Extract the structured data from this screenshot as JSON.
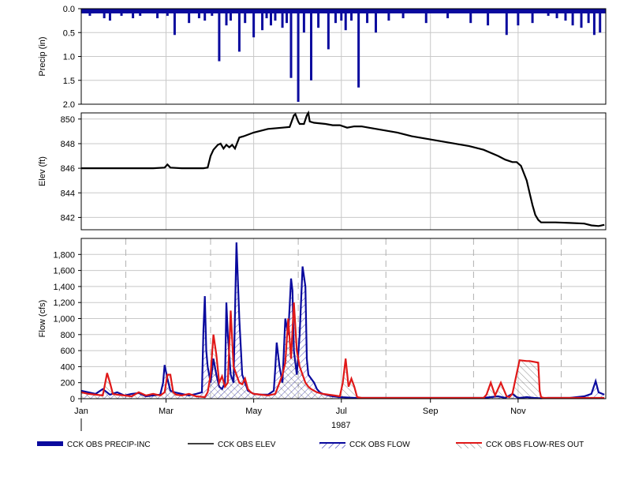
{
  "chart_data": [
    {
      "type": "bar",
      "ylabel": "Precip (in)",
      "ylim": [
        0,
        2.0
      ],
      "inverted_y": true,
      "yticks": [
        "0.0",
        "0.5",
        "1.0",
        "1.5",
        "2.0"
      ],
      "ytick_values": [
        0,
        0.5,
        1.0,
        1.5,
        2.0
      ],
      "series": [
        {
          "name": "CCK OBS PRECIP-INC",
          "color": "#0a0a9e",
          "days": [
            6,
            8,
            16,
            20,
            28,
            32,
            36,
            41,
            50,
            53,
            57,
            60,
            65,
            75,
            82,
            86,
            91,
            96,
            101,
            104,
            110,
            114,
            120,
            126,
            129,
            132,
            135,
            140,
            143,
            146,
            151,
            155,
            160,
            165,
            172,
            177,
            181,
            184,
            188,
            193,
            199,
            205,
            214,
            224,
            240,
            255,
            271,
            283,
            296,
            304,
            314,
            325,
            331,
            337,
            342,
            348,
            353,
            357,
            361
          ],
          "values": [
            0.15,
            0.1,
            0.2,
            0.25,
            0.15,
            0.1,
            0.2,
            0.15,
            0.1,
            0.2,
            0.1,
            0.15,
            0.55,
            0.3,
            0.2,
            0.25,
            0.15,
            1.1,
            0.35,
            0.25,
            0.9,
            0.3,
            0.6,
            0.45,
            0.2,
            0.35,
            0.25,
            0.4,
            0.3,
            1.45,
            1.95,
            0.5,
            1.5,
            0.4,
            0.85,
            0.3,
            0.25,
            0.45,
            0.25,
            1.65,
            0.3,
            0.5,
            0.25,
            0.2,
            0.3,
            0.2,
            0.3,
            0.35,
            0.55,
            0.35,
            0.3,
            0.15,
            0.2,
            0.25,
            0.35,
            0.4,
            0.3,
            0.55,
            0.5
          ]
        }
      ]
    },
    {
      "type": "line",
      "ylabel": "Elev (ft)",
      "ylim": [
        841,
        850.5
      ],
      "yticks": [
        "842",
        "844",
        "846",
        "848",
        "850"
      ],
      "ytick_values": [
        842,
        844,
        846,
        848,
        850
      ],
      "series": [
        {
          "name": "CCK OBS ELEV",
          "color": "#000000",
          "days": [
            0,
            10,
            20,
            30,
            40,
            50,
            58,
            60,
            62,
            70,
            80,
            85,
            88,
            90,
            92,
            95,
            97,
            99,
            101,
            103,
            105,
            107,
            110,
            113,
            120,
            130,
            140,
            145,
            148,
            149,
            151,
            152,
            155,
            157,
            158,
            159,
            162,
            170,
            175,
            180,
            185,
            190,
            195,
            200,
            210,
            220,
            230,
            240,
            250,
            260,
            270,
            280,
            290,
            295,
            300,
            303,
            306,
            310,
            312,
            314,
            316,
            318,
            320,
            330,
            340,
            350,
            355,
            360,
            364
          ],
          "values": [
            846.0,
            846.0,
            846.0,
            846.0,
            846.0,
            846.0,
            846.05,
            846.3,
            846.05,
            846.0,
            846.0,
            846.0,
            846.05,
            847.0,
            847.5,
            847.9,
            848.0,
            847.6,
            847.9,
            847.7,
            847.9,
            847.6,
            848.5,
            848.6,
            848.9,
            849.2,
            849.3,
            849.35,
            850.3,
            850.4,
            849.8,
            849.6,
            849.6,
            850.3,
            850.5,
            849.8,
            849.7,
            849.6,
            849.5,
            849.5,
            849.3,
            849.4,
            849.4,
            849.3,
            849.1,
            848.9,
            848.6,
            848.4,
            848.2,
            848.0,
            847.8,
            847.5,
            847.0,
            846.7,
            846.5,
            846.5,
            846.2,
            845.0,
            844.0,
            843.0,
            842.2,
            841.8,
            841.6,
            841.6,
            841.55,
            841.5,
            841.35,
            841.3,
            841.4
          ]
        }
      ]
    },
    {
      "type": "line",
      "ylabel": "Flow (cfs)",
      "ylim": [
        0,
        2000
      ],
      "yticks": [
        "0",
        "200",
        "400",
        "600",
        "800",
        "1,000",
        "1,200",
        "1,400",
        "1,600",
        "1,800"
      ],
      "ytick_values": [
        0,
        200,
        400,
        600,
        800,
        1000,
        1200,
        1400,
        1600,
        1800
      ],
      "xticks": [
        "Jan",
        "Mar",
        "May",
        "Jul",
        "Sep",
        "Nov"
      ],
      "xtick_days": [
        0,
        59,
        120,
        181,
        243,
        304
      ],
      "xgrid_dashed_days": [
        31,
        90,
        151,
        212,
        273,
        334
      ],
      "xlabel": "1987",
      "series": [
        {
          "name": "CCK OBS FLOW",
          "color": "#0a0a9e",
          "days": [
            0,
            5,
            10,
            15,
            20,
            25,
            30,
            35,
            40,
            45,
            50,
            55,
            57,
            58,
            60,
            62,
            65,
            70,
            75,
            80,
            84,
            85,
            86,
            87,
            88,
            90,
            92,
            94,
            96,
            98,
            100,
            101,
            102,
            104,
            106,
            108,
            110,
            112,
            114,
            116,
            118,
            120,
            125,
            130,
            134,
            135,
            136,
            138,
            140,
            142,
            144,
            146,
            147,
            148,
            150,
            152,
            154,
            156,
            157,
            158,
            160,
            162,
            164,
            166,
            168,
            170,
            175,
            180,
            185,
            190,
            200,
            220,
            240,
            260,
            280,
            290,
            295,
            300,
            303,
            305,
            310,
            315,
            320,
            325,
            330,
            340,
            350,
            355,
            358,
            360,
            364
          ],
          "values": [
            100,
            80,
            60,
            120,
            50,
            80,
            40,
            60,
            70,
            30,
            40,
            50,
            200,
            420,
            250,
            100,
            80,
            60,
            40,
            60,
            80,
            850,
            1280,
            600,
            400,
            200,
            500,
            300,
            150,
            120,
            200,
            1200,
            800,
            300,
            200,
            1950,
            1000,
            300,
            200,
            100,
            80,
            60,
            50,
            50,
            100,
            380,
            700,
            400,
            200,
            1000,
            800,
            1500,
            1350,
            600,
            300,
            800,
            1650,
            1400,
            500,
            300,
            250,
            200,
            120,
            80,
            60,
            50,
            30,
            20,
            15,
            10,
            10,
            10,
            10,
            10,
            10,
            30,
            10,
            60,
            20,
            10,
            20,
            10,
            5,
            10,
            10,
            10,
            30,
            60,
            220,
            80,
            50
          ]
        },
        {
          "name": "CCK OBS FLOW-RES OUT",
          "color": "#e01818",
          "days": [
            0,
            5,
            10,
            15,
            18,
            20,
            22,
            25,
            30,
            35,
            40,
            45,
            50,
            55,
            58,
            60,
            62,
            64,
            66,
            70,
            75,
            80,
            86,
            88,
            90,
            92,
            94,
            96,
            98,
            100,
            102,
            104,
            106,
            108,
            110,
            112,
            114,
            116,
            118,
            120,
            125,
            130,
            135,
            138,
            140,
            142,
            144,
            146,
            148,
            150,
            152,
            154,
            156,
            158,
            160,
            162,
            164,
            168,
            172,
            176,
            180,
            182,
            184,
            186,
            188,
            190,
            192,
            195,
            200,
            220,
            240,
            260,
            270,
            280,
            282,
            285,
            288,
            292,
            296,
            298,
            300,
            305,
            310,
            312,
            318,
            319,
            320,
            322,
            330,
            340,
            350,
            364
          ],
          "values": [
            80,
            60,
            50,
            40,
            320,
            200,
            60,
            50,
            40,
            30,
            80,
            40,
            60,
            40,
            80,
            300,
            300,
            80,
            50,
            40,
            60,
            30,
            20,
            80,
            300,
            800,
            550,
            200,
            280,
            150,
            200,
            1100,
            400,
            300,
            200,
            180,
            250,
            120,
            80,
            60,
            50,
            40,
            60,
            200,
            300,
            450,
            1000,
            500,
            1200,
            600,
            400,
            300,
            200,
            150,
            120,
            100,
            80,
            60,
            50,
            40,
            30,
            200,
            500,
            150,
            250,
            150,
            20,
            10,
            10,
            10,
            10,
            10,
            10,
            10,
            50,
            200,
            40,
            200,
            30,
            20,
            60,
            480,
            470,
            470,
            450,
            100,
            20,
            10,
            10,
            10,
            10,
            10
          ]
        }
      ]
    }
  ],
  "legend": {
    "items": [
      {
        "label": "CCK OBS PRECIP-INC",
        "color": "#0a0a9e",
        "style": "thick-bar"
      },
      {
        "label": "CCK OBS ELEV",
        "color": "#000000",
        "style": "line"
      },
      {
        "label": "CCK OBS FLOW",
        "color": "#0a0a9e",
        "style": "hatched"
      },
      {
        "label": "CCK OBS FLOW-RES OUT",
        "color": "#e01818",
        "style": "hatched"
      }
    ]
  }
}
